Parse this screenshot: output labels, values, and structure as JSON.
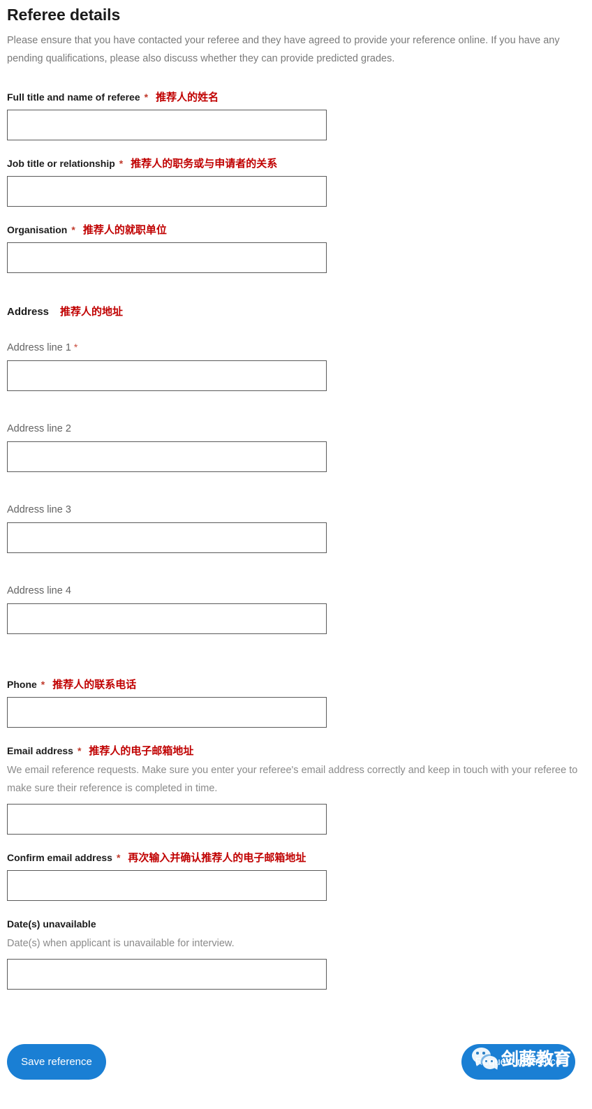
{
  "page": {
    "title": "Referee details",
    "intro": "Please ensure that you have contacted your referee and they have agreed to provide your reference online. If you have any pending qualifications, please also discuss whether they can provide predicted grades."
  },
  "fields": {
    "full_name": {
      "label": "Full title and name of referee",
      "required_mark": "*",
      "annotation": "推荐人的姓名",
      "value": "",
      "placeholder": ""
    },
    "job_title": {
      "label": "Job title or relationship",
      "required_mark": "*",
      "annotation": "推荐人的职务或与申请者的关系",
      "value": "",
      "placeholder": ""
    },
    "organisation": {
      "label": "Organisation",
      "required_mark": "*",
      "annotation": "推荐人的就职单位",
      "value": "",
      "placeholder": ""
    },
    "address_heading": {
      "label": "Address",
      "annotation": "推荐人的地址"
    },
    "address_line_1": {
      "label": "Address line 1",
      "required_mark": "*",
      "value": "",
      "placeholder": ""
    },
    "address_line_2": {
      "label": "Address line 2",
      "value": "",
      "placeholder": ""
    },
    "address_line_3": {
      "label": "Address line 3",
      "value": "",
      "placeholder": ""
    },
    "address_line_4": {
      "label": "Address line 4",
      "value": "",
      "placeholder": ""
    },
    "phone": {
      "label": "Phone",
      "required_mark": "*",
      "annotation": "推荐人的联系电话",
      "value": "",
      "placeholder": ""
    },
    "email": {
      "label": "Email address",
      "required_mark": "*",
      "annotation": "推荐人的电子邮箱地址",
      "hint": "We email reference requests. Make sure you enter your referee's email address correctly and keep in touch with your referee to make sure their reference is completed in time.",
      "value": "",
      "placeholder": ""
    },
    "confirm_email": {
      "label": "Confirm email address",
      "required_mark": "*",
      "annotation": "再次输入并确认推荐人的电子邮箱地址",
      "value": "",
      "placeholder": ""
    },
    "dates_unavailable": {
      "label": "Date(s) unavailable",
      "hint": "Date(s) when applicant is unavailable for interview.",
      "value": "",
      "placeholder": ""
    }
  },
  "footer": {
    "save_label": "Save reference",
    "request_label": "Request reference"
  },
  "watermark": {
    "text": "剑藤教育",
    "icon": "wechat-icon"
  },
  "colors": {
    "accent_blue": "#1a7fd4",
    "annotation_red": "#c00000",
    "required_red": "#c0392b",
    "label_dark": "#1b1b1b",
    "muted_gray": "#7a7a7a",
    "input_border": "#5a5a5a"
  }
}
